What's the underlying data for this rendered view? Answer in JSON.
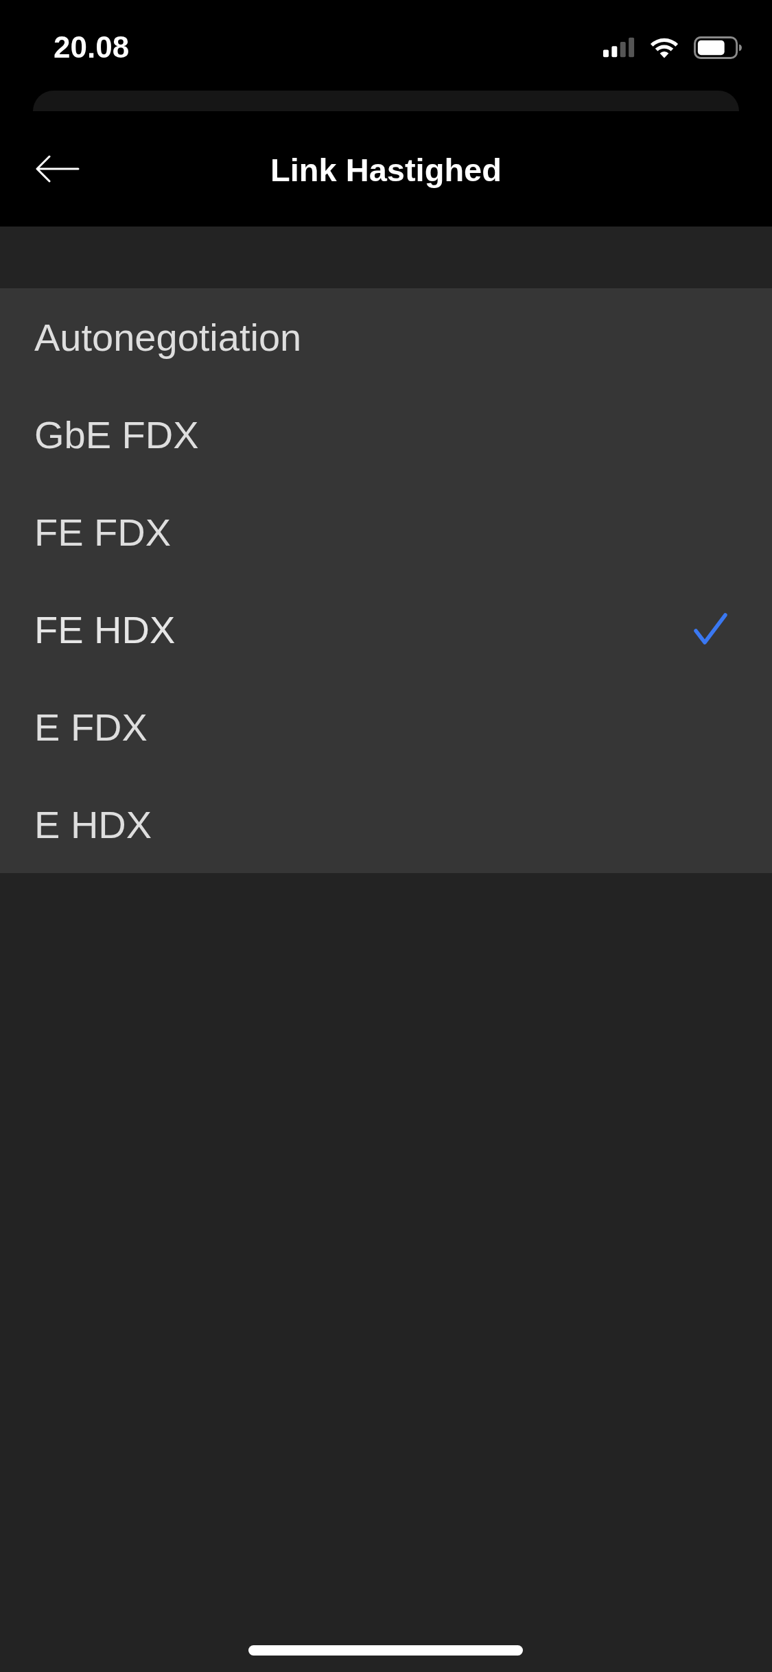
{
  "status_bar": {
    "time": "20.08"
  },
  "header": {
    "title": "Link Hastighed"
  },
  "options": [
    {
      "label": "Autonegotiation",
      "selected": false
    },
    {
      "label": "GbE FDX",
      "selected": false
    },
    {
      "label": "FE FDX",
      "selected": false
    },
    {
      "label": "FE HDX",
      "selected": true
    },
    {
      "label": "E FDX",
      "selected": false
    },
    {
      "label": "E HDX",
      "selected": false
    }
  ]
}
